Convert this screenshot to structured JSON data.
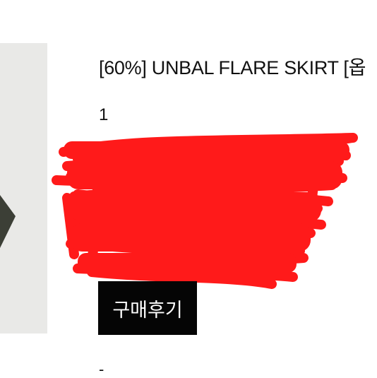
{
  "product": {
    "title": "[60%] UNBAL FLARE SKIRT [옵",
    "quantity": "1"
  },
  "actions": {
    "review_label": "구매후기"
  },
  "footer": {
    "dash": "-"
  },
  "colors": {
    "thumbnail_bg": "#e9e9e7",
    "garment": "#3c3f36",
    "redaction": "#ff1a1a",
    "button_bg": "#050505",
    "button_text": "#ffffff"
  }
}
